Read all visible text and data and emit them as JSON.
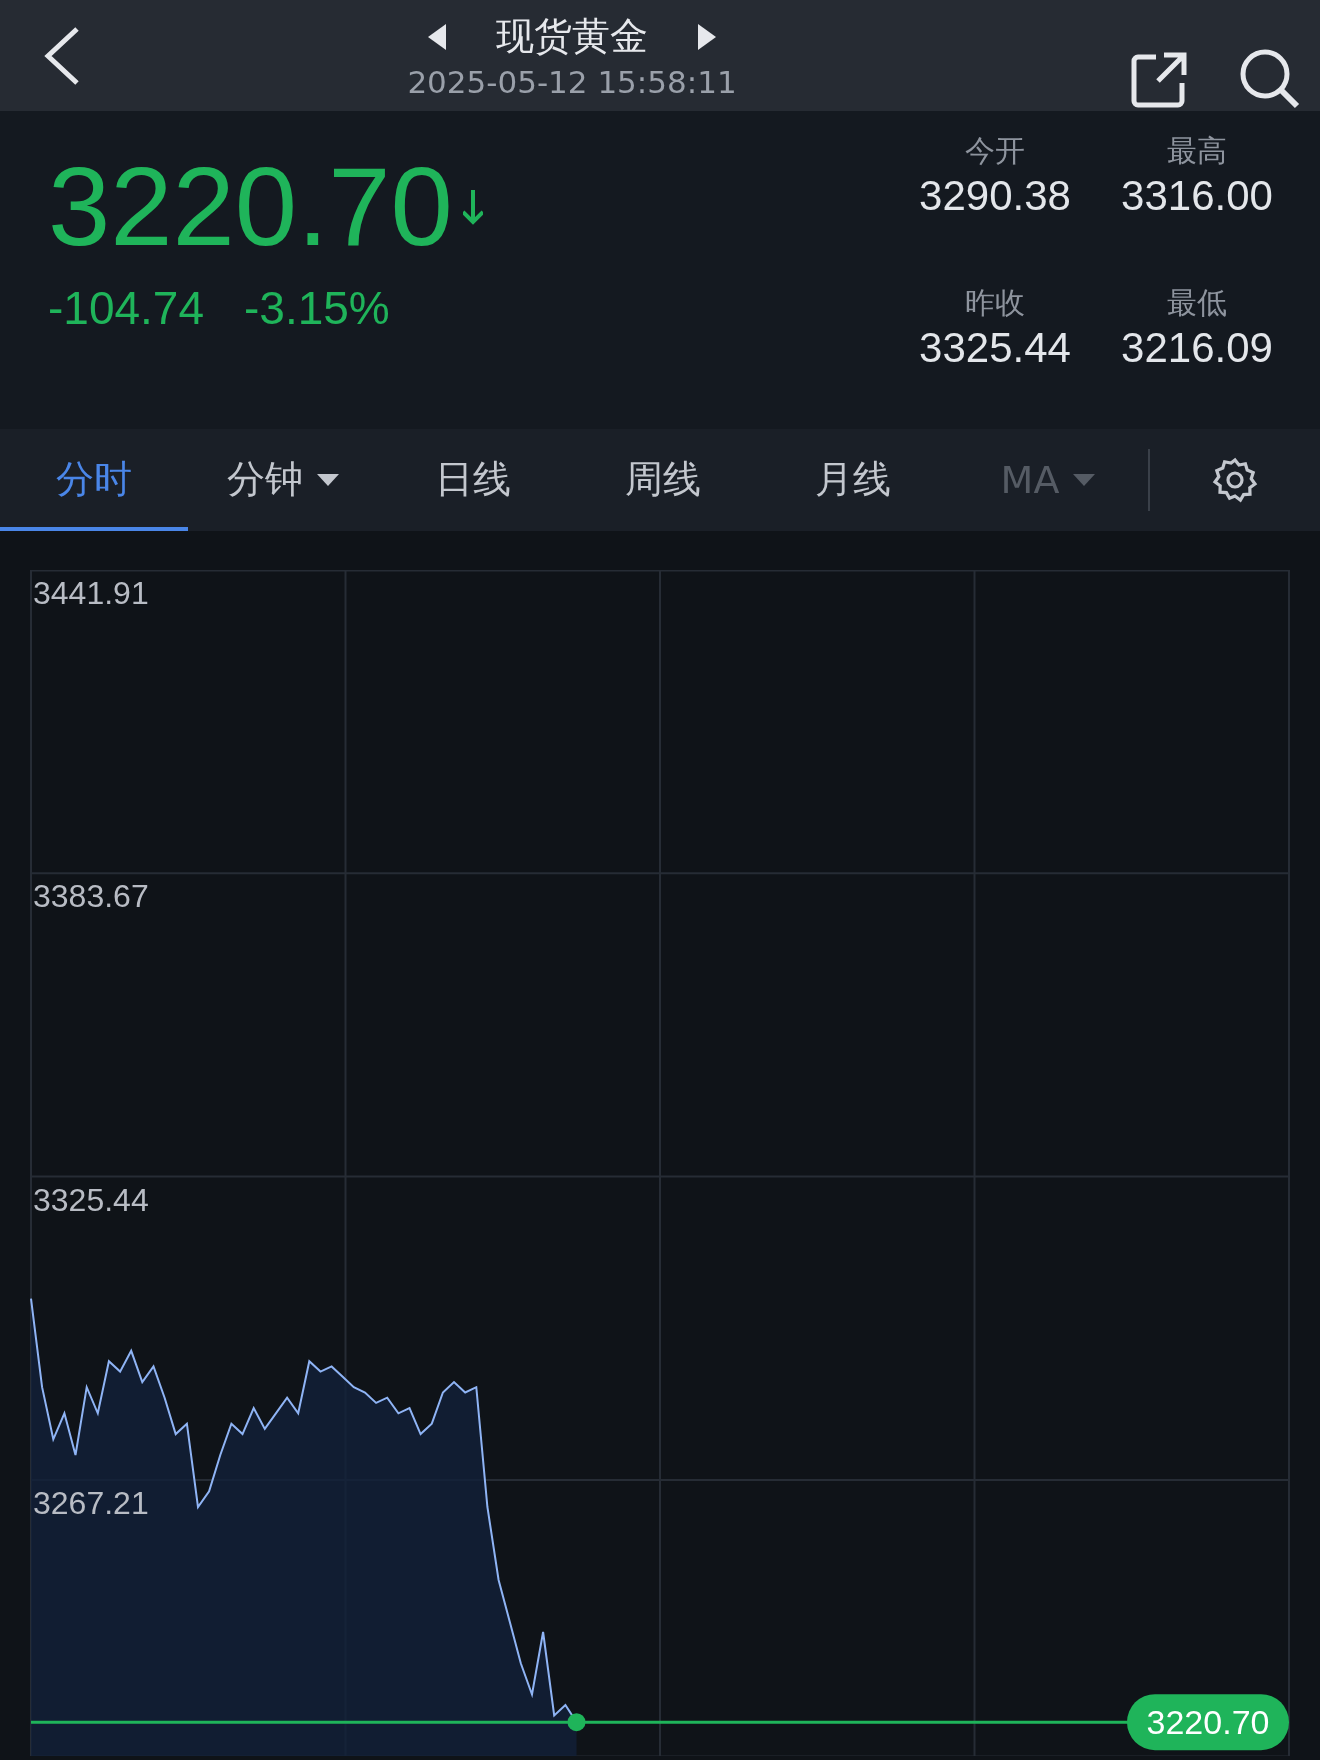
{
  "nav": {
    "title": "现货黄金",
    "timestamp": "2025-05-12 15:58:11"
  },
  "quote": {
    "price": "3220.70",
    "falling": true,
    "change": "-104.74",
    "change_percent": "-3.15%",
    "stats": [
      {
        "label": "今开",
        "value": "3290.38"
      },
      {
        "label": "最高",
        "value": "3316.00"
      },
      {
        "label": "昨收",
        "value": "3325.44"
      },
      {
        "label": "最低",
        "value": "3216.09"
      }
    ]
  },
  "tabs": [
    {
      "label": "分时",
      "selected": true,
      "dropdown": false,
      "disabled": false
    },
    {
      "label": "分钟",
      "selected": false,
      "dropdown": true,
      "disabled": false
    },
    {
      "label": "日线",
      "selected": false,
      "dropdown": false,
      "disabled": false
    },
    {
      "label": "周线",
      "selected": false,
      "dropdown": false,
      "disabled": false
    },
    {
      "label": "月线",
      "selected": false,
      "dropdown": false,
      "disabled": false
    },
    {
      "label": "MA",
      "selected": false,
      "dropdown": true,
      "disabled": true
    }
  ],
  "chart": {
    "chart_data": {
      "type": "area",
      "grid": true,
      "ylim": [
        3214.2,
        3441.91
      ],
      "yticks": [
        {
          "value": 3441.91,
          "label": "3441.91"
        },
        {
          "value": 3383.67,
          "label": "3383.67"
        },
        {
          "value": 3325.44,
          "label": "3325.44"
        },
        {
          "value": 3267.21,
          "label": "3267.21"
        }
      ],
      "categories": [
        null,
        null,
        null,
        null,
        null,
        null,
        null,
        null,
        null,
        null,
        null,
        null,
        null,
        null,
        null,
        null,
        null,
        null,
        null,
        null,
        null,
        null,
        null,
        null,
        null,
        null,
        null,
        null,
        null,
        null,
        null,
        null,
        null,
        null,
        null,
        null,
        null,
        null,
        null,
        null,
        null,
        null,
        null,
        null,
        null,
        null,
        null,
        null,
        null,
        null,
        null,
        null,
        null,
        null,
        null,
        null,
        null,
        null,
        null,
        null,
        null,
        null,
        null,
        null,
        null,
        null,
        null,
        null,
        null,
        null,
        null,
        null,
        null,
        null,
        null,
        null,
        null,
        null,
        null,
        null,
        null,
        null,
        null,
        null,
        null,
        null,
        null,
        null,
        null,
        null,
        null,
        null,
        null,
        null,
        null,
        null,
        null,
        null,
        null,
        null,
        null,
        null,
        null,
        null,
        null,
        null,
        null,
        null,
        null,
        null,
        null,
        null,
        null,
        null
      ],
      "series": [
        {
          "color": "#8fb4f5",
          "values": [
            3302,
            3285,
            3275,
            3280,
            3272,
            3285,
            3280,
            3290,
            3288,
            3292,
            3286,
            3289,
            3283,
            3276,
            3278,
            3262,
            3265,
            3272,
            3278,
            3276,
            3281,
            3277,
            3280,
            3283,
            3280,
            3290,
            3288,
            3289,
            3287,
            3285,
            3284,
            3282,
            3283,
            3280,
            3281,
            3276,
            3278,
            3284,
            3286,
            3284,
            3285,
            3262,
            3248,
            3240,
            3232,
            3226,
            3238,
            3222,
            3224,
            3220.7,
            null,
            null,
            null,
            null,
            null,
            null,
            null,
            null,
            null,
            null,
            null,
            null,
            null,
            null,
            null,
            null,
            null,
            null,
            null,
            null,
            null,
            null,
            null,
            null,
            null,
            null,
            null,
            null,
            null,
            null,
            null,
            null,
            null,
            null,
            null,
            null,
            null,
            null,
            null,
            null,
            null,
            null,
            null,
            null,
            null,
            null,
            null,
            null,
            null,
            null,
            null,
            null,
            null,
            null,
            null,
            null,
            null,
            null,
            null,
            null,
            null,
            null,
            null,
            null
          ]
        }
      ],
      "ref_lines": [
        {
          "axis": "y",
          "value": 3220.7,
          "label": "3220.70",
          "color": "#1fb45a"
        }
      ]
    }
  }
}
